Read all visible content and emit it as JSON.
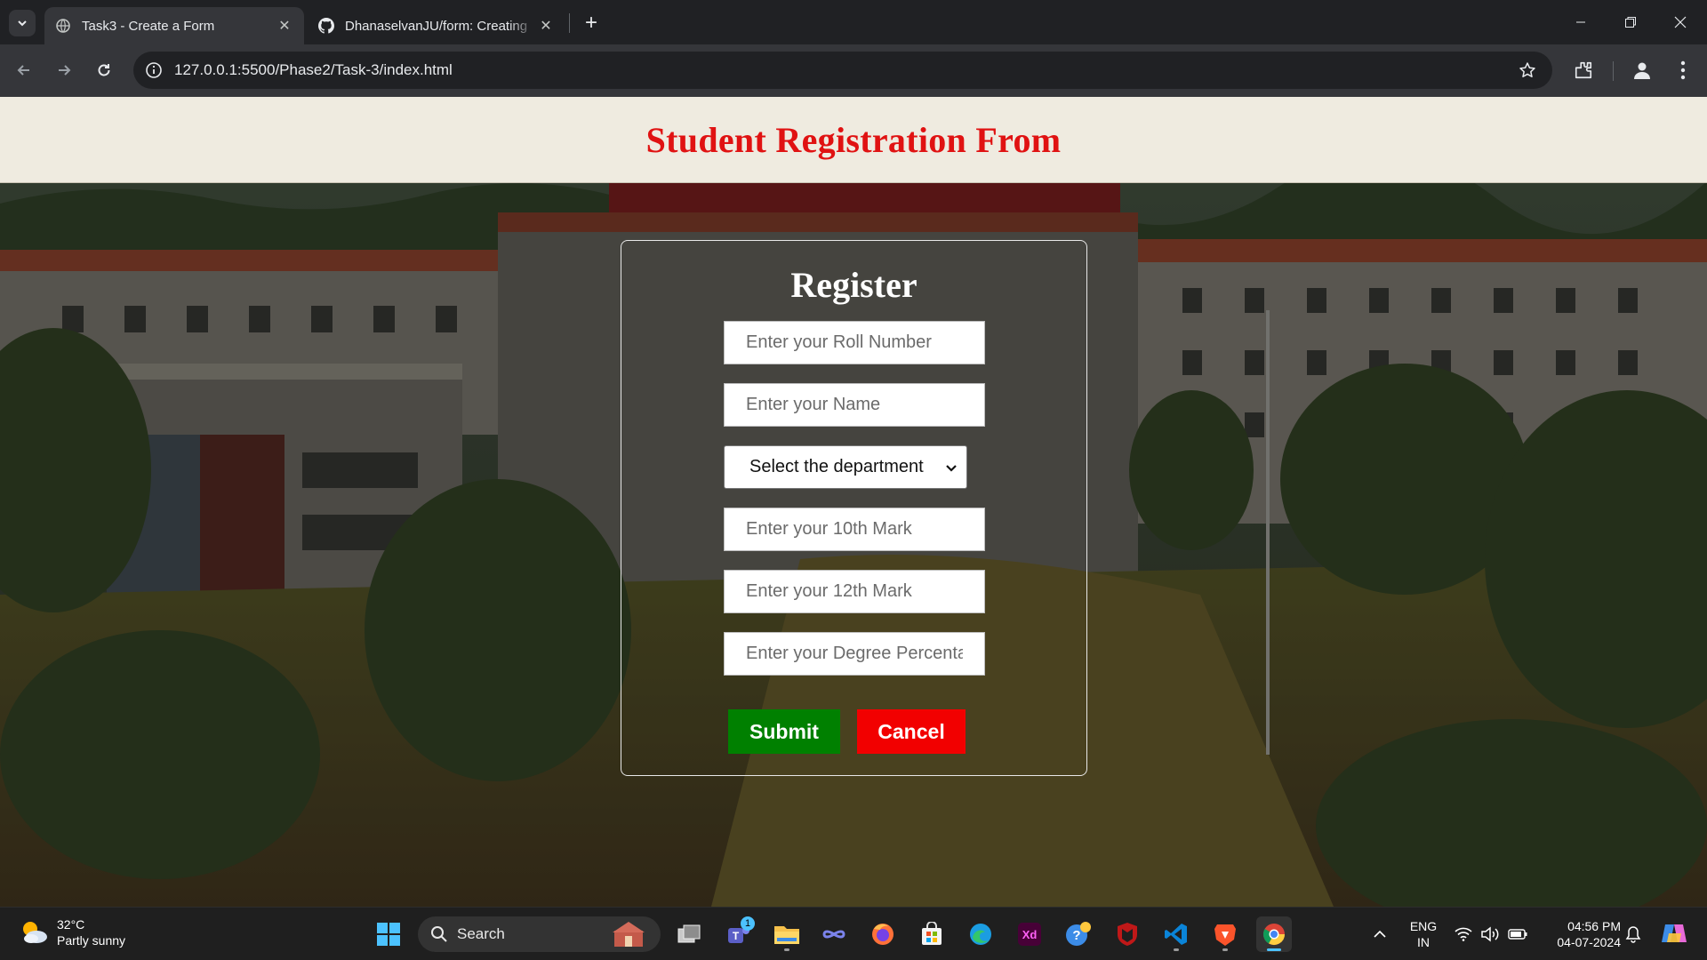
{
  "browser": {
    "tabs": [
      {
        "title": "Task3 - Create a Form",
        "active": true,
        "favicon": "globe-icon"
      },
      {
        "title": "DhanaselvanJU/form: Creating",
        "active": false,
        "favicon": "github-icon"
      }
    ],
    "url": "127.0.0.1:5500/Phase2/Task-3/index.html"
  },
  "page": {
    "header_title": "Student Registration From",
    "form": {
      "title": "Register",
      "roll_placeholder": "Enter your Roll Number",
      "name_placeholder": "Enter your Name",
      "department_selected": "Select the department",
      "tenth_placeholder": "Enter your 10th Mark",
      "twelfth_placeholder": "Enter your 12th Mark",
      "degree_placeholder": "Enter your Degree Percentage",
      "submit_label": "Submit",
      "cancel_label": "Cancel"
    },
    "colors": {
      "title_red": "#e01212",
      "submit_green": "#008000",
      "cancel_red": "#f20000"
    }
  },
  "taskbar": {
    "weather": {
      "temp": "32°C",
      "condition": "Partly sunny"
    },
    "search_label": "Search",
    "apps": [
      "windows-start-icon",
      "task-view-icon",
      "teams-icon",
      "file-explorer-icon",
      "copilot-icon",
      "firefox-icon",
      "microsoft-store-icon",
      "edge-icon",
      "adobe-xd-icon",
      "help-icon",
      "mcafee-icon",
      "vscode-icon",
      "brave-icon",
      "chrome-icon"
    ],
    "teams_badge": "1",
    "language": {
      "line1": "ENG",
      "line2": "IN"
    },
    "clock": {
      "time": "04:56 PM",
      "date": "04-07-2024"
    }
  }
}
